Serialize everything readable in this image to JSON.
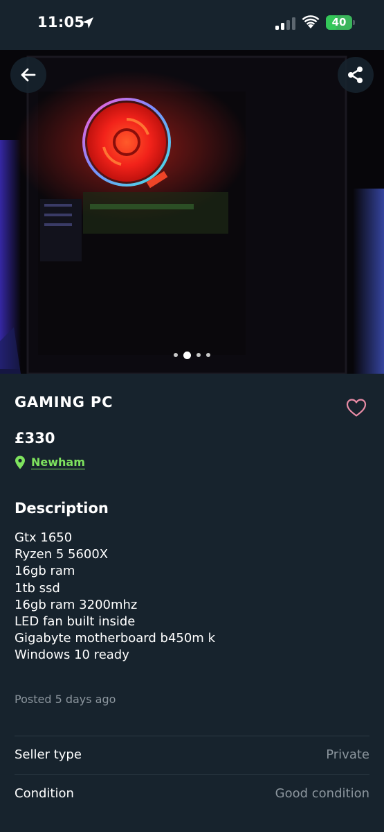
{
  "status_bar": {
    "time": "11:05",
    "battery_level": "40",
    "battery_fraction": 0.4,
    "icons": [
      "location-arrow-icon",
      "signal-icon",
      "wifi-icon",
      "battery-icon"
    ]
  },
  "hero": {
    "icons": [
      "back-arrow-icon",
      "share-icon"
    ],
    "carousel": {
      "total": 4,
      "active_index": 1
    }
  },
  "listing": {
    "title": "GAMING PC",
    "price": "£330",
    "location": "Newham",
    "description_heading": "Description",
    "description_lines": [
      "Gtx 1650",
      "Ryzen 5 5600X",
      "16gb ram",
      "1tb ssd",
      "16gb ram 3200mhz",
      "LED fan built inside",
      "Gigabyte motherboard b450m k",
      "Windows 10 ready"
    ],
    "posted": "Posted 5 days ago"
  },
  "details": [
    {
      "label": "Seller type",
      "value": "Private"
    },
    {
      "label": "Condition",
      "value": "Good condition"
    }
  ],
  "colors": {
    "background": "#17232d",
    "accent_green": "#7ee35e",
    "heart_pink": "#e98ca6",
    "muted_text": "#8c969e"
  }
}
